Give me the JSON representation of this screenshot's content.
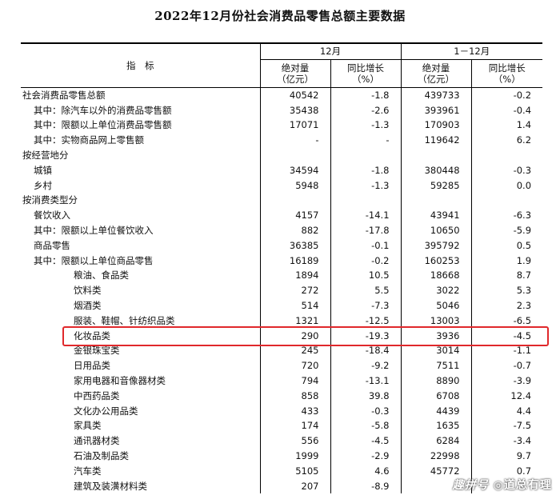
{
  "title": "2022年12月份社会消费品零售总额主要数据",
  "header": {
    "indicator": "指　标",
    "period_dec": "12月",
    "period_ytd": "1－12月",
    "abs_line1": "绝对量",
    "abs_line2": "（亿元）",
    "yoy_line1": "同比增长",
    "yoy_line2": "（%）"
  },
  "rows": [
    {
      "label": "社会消费品零售总额",
      "dec_abs": "40542",
      "dec_yoy": "-1.8",
      "ytd_abs": "439733",
      "ytd_yoy": "-0.2"
    },
    {
      "label": "其中：除汽车以外的消费品零售额",
      "dec_abs": "35438",
      "dec_yoy": "-2.6",
      "ytd_abs": "393961",
      "ytd_yoy": "-0.4"
    },
    {
      "label": "其中：限额以上单位消费品零售额",
      "dec_abs": "17071",
      "dec_yoy": "-1.3",
      "ytd_abs": "170903",
      "ytd_yoy": "1.4"
    },
    {
      "label": "其中：实物商品网上零售额",
      "dec_abs": "-",
      "dec_yoy": "-",
      "ytd_abs": "119642",
      "ytd_yoy": "6.2"
    },
    {
      "label": "按经营地分",
      "dec_abs": "",
      "dec_yoy": "",
      "ytd_abs": "",
      "ytd_yoy": ""
    },
    {
      "label": "城镇",
      "dec_abs": "34594",
      "dec_yoy": "-1.8",
      "ytd_abs": "380448",
      "ytd_yoy": "-0.3"
    },
    {
      "label": "乡村",
      "dec_abs": "5948",
      "dec_yoy": "-1.3",
      "ytd_abs": "59285",
      "ytd_yoy": "0.0"
    },
    {
      "label": "按消费类型分",
      "dec_abs": "",
      "dec_yoy": "",
      "ytd_abs": "",
      "ytd_yoy": ""
    },
    {
      "label": "餐饮收入",
      "dec_abs": "4157",
      "dec_yoy": "-14.1",
      "ytd_abs": "43941",
      "ytd_yoy": "-6.3"
    },
    {
      "label": "其中：限额以上单位餐饮收入",
      "dec_abs": "882",
      "dec_yoy": "-17.8",
      "ytd_abs": "10650",
      "ytd_yoy": "-5.9"
    },
    {
      "label": "商品零售",
      "dec_abs": "36385",
      "dec_yoy": "-0.1",
      "ytd_abs": "395792",
      "ytd_yoy": "0.5"
    },
    {
      "label": "其中：限额以上单位商品零售",
      "dec_abs": "16189",
      "dec_yoy": "-0.2",
      "ytd_abs": "160253",
      "ytd_yoy": "1.9"
    },
    {
      "label": "粮油、食品类",
      "dec_abs": "1894",
      "dec_yoy": "10.5",
      "ytd_abs": "18668",
      "ytd_yoy": "8.7"
    },
    {
      "label": "饮料类",
      "dec_abs": "272",
      "dec_yoy": "5.5",
      "ytd_abs": "3022",
      "ytd_yoy": "5.3"
    },
    {
      "label": "烟酒类",
      "dec_abs": "514",
      "dec_yoy": "-7.3",
      "ytd_abs": "5046",
      "ytd_yoy": "2.3"
    },
    {
      "label": "服装、鞋帽、针纺织品类",
      "dec_abs": "1321",
      "dec_yoy": "-12.5",
      "ytd_abs": "13003",
      "ytd_yoy": "-6.5"
    },
    {
      "label": "化妆品类",
      "dec_abs": "290",
      "dec_yoy": "-19.3",
      "ytd_abs": "3936",
      "ytd_yoy": "-4.5"
    },
    {
      "label": "金银珠宝类",
      "dec_abs": "245",
      "dec_yoy": "-18.4",
      "ytd_abs": "3014",
      "ytd_yoy": "-1.1"
    },
    {
      "label": "日用品类",
      "dec_abs": "720",
      "dec_yoy": "-9.2",
      "ytd_abs": "7511",
      "ytd_yoy": "-0.7"
    },
    {
      "label": "家用电器和音像器材类",
      "dec_abs": "794",
      "dec_yoy": "-13.1",
      "ytd_abs": "8890",
      "ytd_yoy": "-3.9"
    },
    {
      "label": "中西药品类",
      "dec_abs": "858",
      "dec_yoy": "39.8",
      "ytd_abs": "6708",
      "ytd_yoy": "12.4"
    },
    {
      "label": "文化办公用品类",
      "dec_abs": "433",
      "dec_yoy": "-0.3",
      "ytd_abs": "4439",
      "ytd_yoy": "4.4"
    },
    {
      "label": "家具类",
      "dec_abs": "174",
      "dec_yoy": "-5.8",
      "ytd_abs": "1635",
      "ytd_yoy": "-7.5"
    },
    {
      "label": "通讯器材类",
      "dec_abs": "556",
      "dec_yoy": "-4.5",
      "ytd_abs": "6284",
      "ytd_yoy": "-3.4"
    },
    {
      "label": "石油及制品类",
      "dec_abs": "1999",
      "dec_yoy": "-2.9",
      "ytd_abs": "22998",
      "ytd_yoy": "9.7"
    },
    {
      "label": "汽车类",
      "dec_abs": "5105",
      "dec_yoy": "4.6",
      "ytd_abs": "45772",
      "ytd_yoy": "0.7"
    },
    {
      "label": "建筑及装潢材料类",
      "dec_abs": "207",
      "dec_yoy": "-8.9",
      "ytd_abs": "",
      "ytd_yoy": ""
    }
  ],
  "highlight_color": "#e0282b",
  "watermark": {
    "left": "趣拼号",
    "right": "道总有理"
  }
}
